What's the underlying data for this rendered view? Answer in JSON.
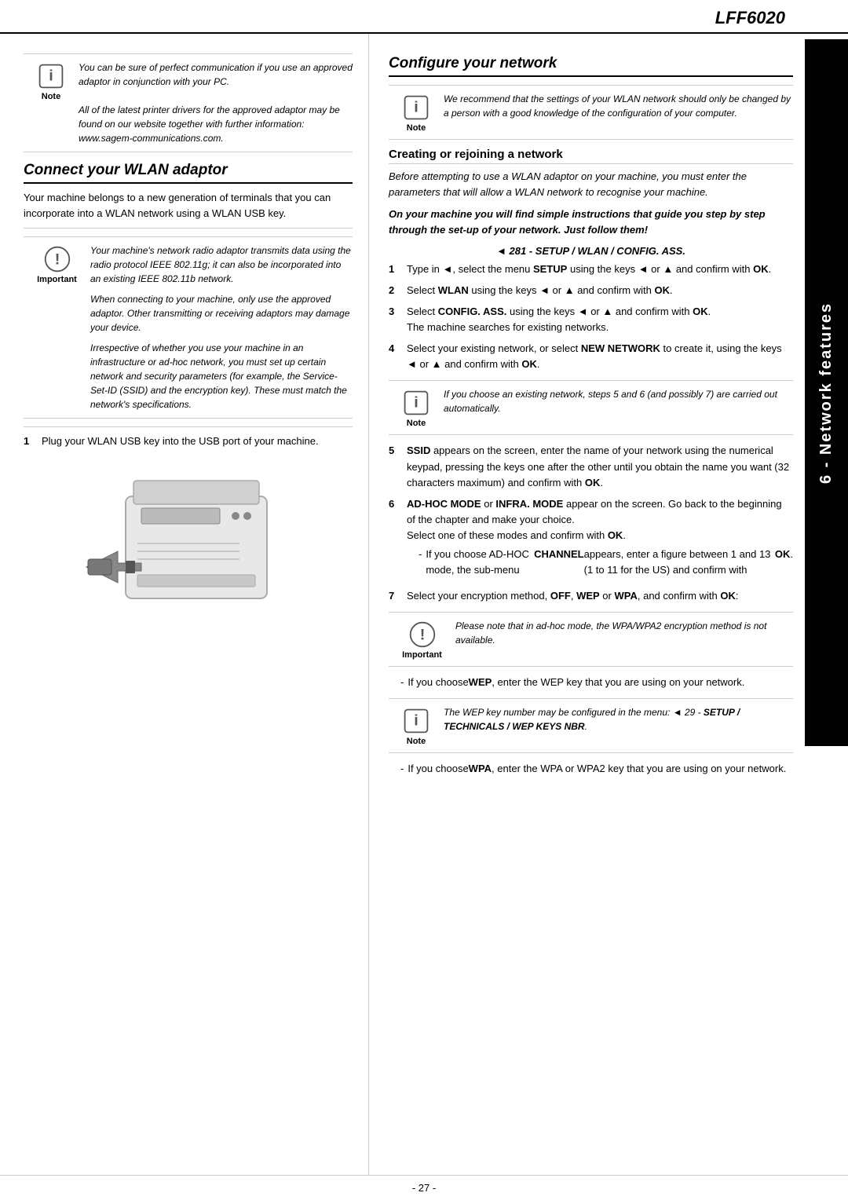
{
  "header": {
    "title": "LFF6020"
  },
  "side_label": {
    "text": "6 - Network features"
  },
  "footer": {
    "page_number": "- 27 -"
  },
  "left_column": {
    "note1": {
      "label": "Note",
      "lines": [
        "You can be sure of perfect communication if you use an approved adaptor in conjunction with your PC.",
        "All of the latest printer drivers for the approved adaptor may be found on our website together with further information: www.sagem-communications.com."
      ]
    },
    "section1_title": "Connect your WLAN adaptor",
    "section1_body": "Your machine belongs to a new generation of terminals that you can incorporate into a WLAN network using a WLAN USB key.",
    "important1": {
      "label": "Important",
      "lines": [
        "Your machine's network radio adaptor transmits data using the radio protocol IEEE 802.11g; it can also be incorporated into an existing IEEE 802.11b network.",
        "When connecting to your machine, only use the approved adaptor. Other transmitting or receiving adaptors may damage your device.",
        "Irrespective of whether you use your machine in an infrastructure or ad-hoc network, you must set up certain network and security parameters (for example, the Service-Set-ID (SSID) and the encryption key). These must match the network's specifications."
      ]
    },
    "step1": "Plug your WLAN USB key into the USB port of your machine."
  },
  "right_column": {
    "section2_title": "Configure your network",
    "note2": {
      "label": "Note",
      "text": "We recommend that the settings of your WLAN network should only be changed by a person with a good knowledge of the configuration of your computer."
    },
    "subsection1_title": "Creating or rejoining a network",
    "intro_italic": "Before attempting to use a WLAN adaptor on your machine, you must enter the parameters that will allow a WLAN network to recognise your machine.",
    "bold_instruction": "On your machine you will find simple instructions that guide you step by step through the set-up of your network. Just follow them!",
    "command": "◄ 281 - SETUP / WLAN / CONFIG. ASS.",
    "steps": [
      {
        "num": "1",
        "text": "Type in ◄, select the menu SETUP using the keys ◄ or ▲ and confirm with OK."
      },
      {
        "num": "2",
        "text": "Select WLAN using the keys ◄ or ▲ and confirm with OK."
      },
      {
        "num": "3",
        "text": "Select CONFIG. ASS. using the keys ◄ or ▲ and confirm with OK.\nThe machine searches for existing networks."
      },
      {
        "num": "4",
        "text": "Select your existing network, or select NEW NETWORK to create it, using the keys ◄ or ▲ and confirm with OK."
      }
    ],
    "note3": {
      "label": "Note",
      "text": "If you choose an existing network, steps 5 and 6 (and possibly 7) are carried out automatically."
    },
    "steps2": [
      {
        "num": "5",
        "text": "SSID appears on the screen, enter the name of your network using the numerical keypad, pressing the keys one after the other until you obtain the name you want (32 characters maximum) and confirm with OK."
      },
      {
        "num": "6",
        "text": "AD-HOC MODE or INFRA. MODE appear on the screen. Go back to the beginning of the chapter and make your choice.\nSelect one of these modes and confirm with OK.",
        "sublist": [
          "If you choose AD-HOC mode, the sub-menu CHANNEL appears, enter a figure between 1 and 13 (1 to 11 for the US) and confirm with OK."
        ]
      },
      {
        "num": "7",
        "text": "Select your encryption method, OFF, WEP or WPA, and confirm with OK:"
      }
    ],
    "important2": {
      "label": "Important",
      "text": "Please note that in ad-hoc mode, the WPA/WPA2 encryption method is not available."
    },
    "wep_sublist": [
      "If you choose WEP, enter the WEP key that you are using on your network."
    ],
    "note4": {
      "label": "Note",
      "text": "The WEP key number may be configured in the menu: ◄ 29 - SETUP / TECHNICALS / WEP KEYS NBR."
    },
    "wpa_sublist": [
      "If you choose WPA, enter the WPA or WPA2 key that you are using on your network."
    ]
  }
}
